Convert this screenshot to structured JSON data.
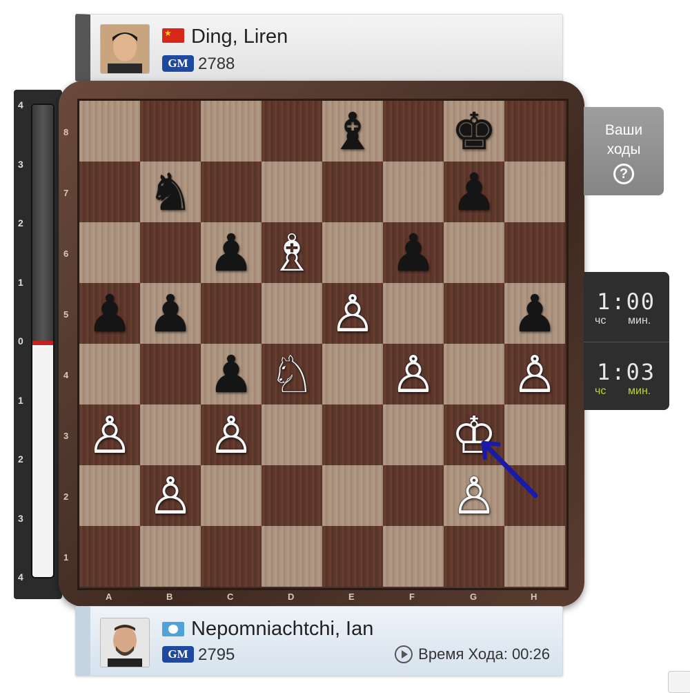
{
  "top_player": {
    "name": "Ding, Liren",
    "title": "GM",
    "rating": "2788",
    "flag": "china-flag"
  },
  "bottom_player": {
    "name": "Nepomniachtchi, Ian",
    "title": "GM",
    "rating": "2795",
    "flag": "fide-flag",
    "move_time": "Время Хода: 00:26"
  },
  "eval_bar": {
    "labels": [
      "4",
      "3",
      "2",
      "1",
      "0",
      "1",
      "2",
      "3",
      "4"
    ],
    "white_share": 0.5
  },
  "board": {
    "ranks": [
      "8",
      "7",
      "6",
      "5",
      "4",
      "3",
      "2",
      "1"
    ],
    "files": [
      "A",
      "B",
      "C",
      "D",
      "E",
      "F",
      "G",
      "H"
    ],
    "pieces": {
      "e8": {
        "glyph": "♝",
        "color": "black"
      },
      "g8": {
        "glyph": "♚",
        "color": "black"
      },
      "b7": {
        "glyph": "♞",
        "color": "black"
      },
      "g7": {
        "glyph": "♟",
        "color": "black"
      },
      "c6": {
        "glyph": "♟",
        "color": "black"
      },
      "d6": {
        "glyph": "♗",
        "color": "white"
      },
      "f6": {
        "glyph": "♟",
        "color": "black"
      },
      "a5": {
        "glyph": "♟",
        "color": "black"
      },
      "b5": {
        "glyph": "♟",
        "color": "black"
      },
      "e5": {
        "glyph": "♙",
        "color": "white"
      },
      "h5": {
        "glyph": "♟",
        "color": "black"
      },
      "c4": {
        "glyph": "♟",
        "color": "black"
      },
      "d4": {
        "glyph": "♘",
        "color": "white"
      },
      "f4": {
        "glyph": "♙",
        "color": "white"
      },
      "h4": {
        "glyph": "♙",
        "color": "white"
      },
      "a3": {
        "glyph": "♙",
        "color": "white"
      },
      "c3": {
        "glyph": "♙",
        "color": "white"
      },
      "g3": {
        "glyph": "♔",
        "color": "white"
      },
      "b2": {
        "glyph": "♙",
        "color": "white"
      },
      "g2": {
        "glyph": "♙",
        "color": "white"
      }
    },
    "last_move_arrow": {
      "from": "h2",
      "to": "g3",
      "color": "#1a1aa8"
    }
  },
  "your_moves": {
    "label": "Ваши ходы",
    "help": "?"
  },
  "clocks": {
    "black": {
      "time": "1:00",
      "hours_label": "чс",
      "minutes_label": "мин."
    },
    "white": {
      "time": "1:03",
      "hours_label": "чс",
      "minutes_label": "мин."
    }
  }
}
